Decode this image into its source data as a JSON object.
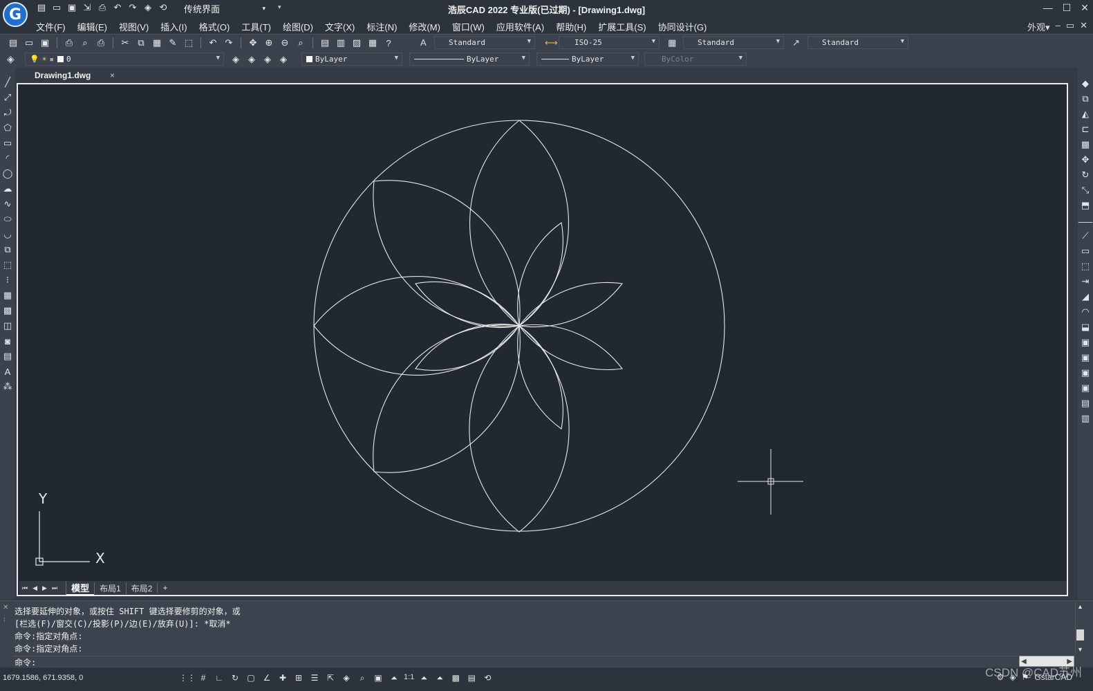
{
  "app": {
    "title": "浩辰CAD 2022 专业版(已过期) - [Drawing1.dwg]",
    "logo_letter": "G",
    "workspace": "传统界面"
  },
  "menu": {
    "items": [
      "文件(F)",
      "编辑(E)",
      "视图(V)",
      "插入(I)",
      "格式(O)",
      "工具(T)",
      "绘图(D)",
      "文字(X)",
      "标注(N)",
      "修改(M)",
      "窗口(W)",
      "应用软件(A)",
      "帮助(H)",
      "扩展工具(S)",
      "协同设计(G)"
    ],
    "right_label": "外观"
  },
  "toolbar": {
    "text_style": "Standard",
    "dim_style": "ISO-25",
    "table_style": "Standard",
    "multileader_style": "Standard",
    "layer": "0",
    "color": "ByLayer",
    "linetype": "ByLayer",
    "lineweight": "ByLayer",
    "plotstyle": "ByColor"
  },
  "document": {
    "tab_label": "Drawing1.dwg",
    "close_glyph": "×"
  },
  "layouts": {
    "tabs": [
      "模型",
      "布局1",
      "布局2"
    ],
    "add": "+"
  },
  "ucs": {
    "x_label": "X",
    "y_label": "Y"
  },
  "command": {
    "lines": [
      "选择要延伸的对象，或按住 SHIFT 键选择要修剪的对象，或",
      "[栏选(F)/窗交(C)/投影(P)/边(E)/放弃(U)]: *取消*",
      "命令:指定对角点:",
      "命令:指定对角点:"
    ],
    "prompt": "命令:"
  },
  "status": {
    "coordinates": "1679.1586, 671.9358, 0",
    "scale": "1:1",
    "app_name": "GstarCAD"
  },
  "watermark": "CSDN @CAD苏州"
}
